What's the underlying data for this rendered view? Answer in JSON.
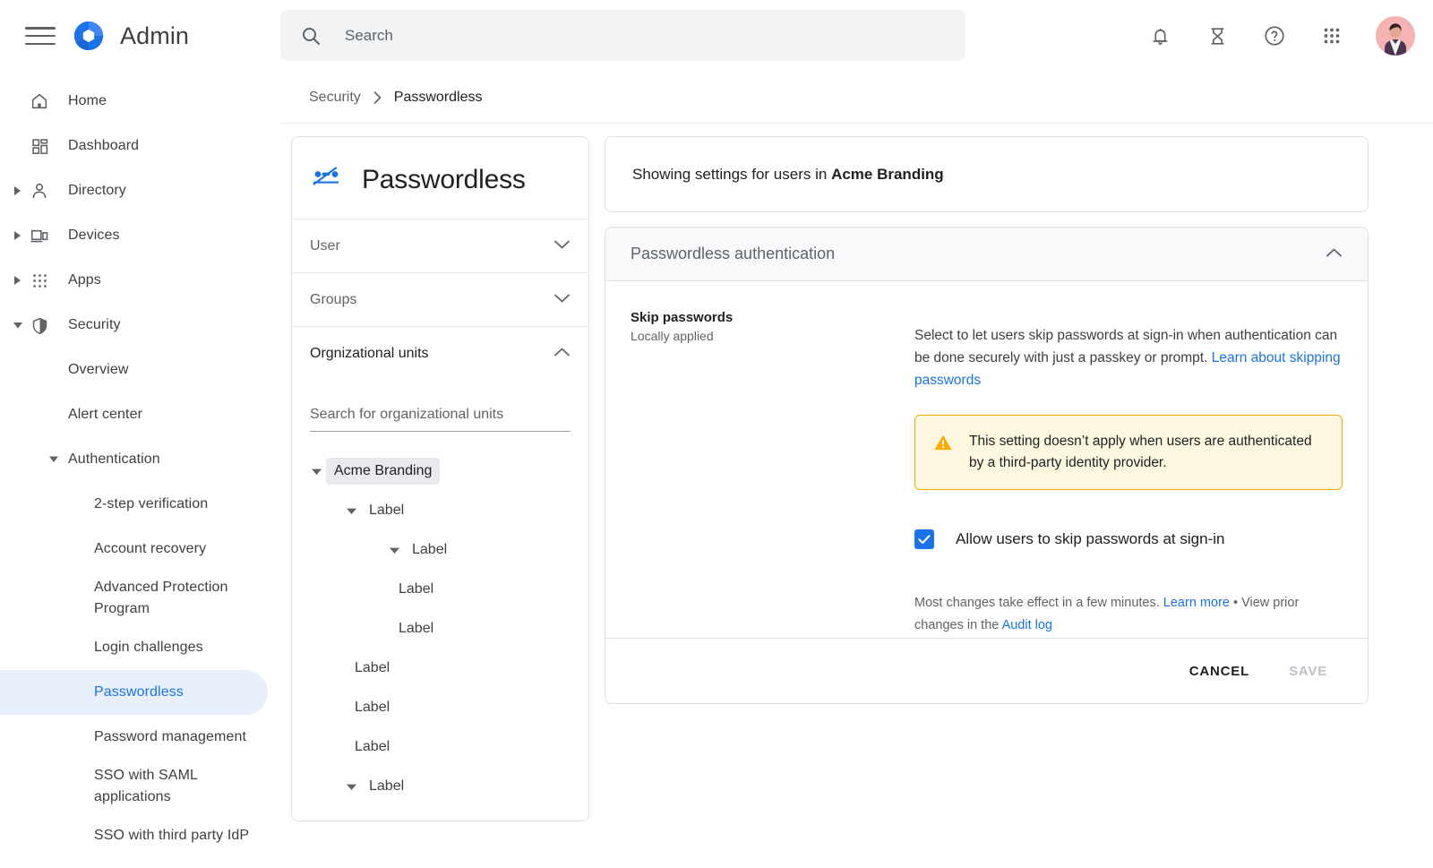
{
  "topbar": {
    "menu_icon": "hamburger-menu-icon",
    "logo_icon": "google-admin-logo",
    "app_title": "Admin",
    "search": {
      "placeholder": "Search",
      "value": "",
      "icon": "search-icon"
    },
    "icons": [
      {
        "name": "notifications-bell-icon",
        "label": "Notifications"
      },
      {
        "name": "hourglass-icon",
        "label": "Tasks"
      },
      {
        "name": "help-circle-icon",
        "label": "Help"
      },
      {
        "name": "apps-grid-icon",
        "label": "Google apps"
      }
    ],
    "avatar": {
      "name": "user-avatar",
      "label": "Account"
    }
  },
  "breadcrumb": {
    "items": [
      {
        "label": "Security",
        "current": false
      },
      {
        "label": "Passwordless",
        "current": true
      }
    ],
    "separator": "›"
  },
  "sidebar": {
    "items": [
      {
        "label": "Home",
        "icon": "home-icon",
        "caret": "none",
        "level": 0
      },
      {
        "label": "Dashboard",
        "icon": "dashboard-icon",
        "caret": "none",
        "level": 0
      },
      {
        "label": "Directory",
        "icon": "person-icon",
        "caret": "collapsed",
        "level": 0
      },
      {
        "label": "Devices",
        "icon": "devices-icon",
        "caret": "collapsed",
        "level": 0
      },
      {
        "label": "Apps",
        "icon": "apps-grid-icon",
        "caret": "collapsed",
        "level": 0
      },
      {
        "label": "Security",
        "icon": "shield-icon",
        "caret": "expanded",
        "level": 0
      }
    ],
    "security_children": [
      {
        "label": "Overview",
        "level": 1,
        "caret": "none",
        "active": false
      },
      {
        "label": "Alert center",
        "level": 1,
        "caret": "none",
        "active": false
      },
      {
        "label": "Authentication",
        "level": 1,
        "caret": "expanded",
        "active": false
      },
      {
        "label": "2-step verification",
        "level": 2,
        "caret": "none",
        "active": false
      },
      {
        "label": "Account recovery",
        "level": 2,
        "caret": "none",
        "active": false
      },
      {
        "label": "Advanced Protection Program",
        "level": 2,
        "caret": "none",
        "active": false
      },
      {
        "label": "Login challenges",
        "level": 2,
        "caret": "none",
        "active": false
      },
      {
        "label": "Passwordless",
        "level": 2,
        "caret": "none",
        "active": true
      },
      {
        "label": "Password management",
        "level": 2,
        "caret": "none",
        "active": false
      },
      {
        "label": "SSO with SAML applications",
        "level": 2,
        "caret": "none",
        "active": false
      },
      {
        "label": "SSO with third party IdP",
        "level": 2,
        "caret": "none",
        "active": false
      }
    ]
  },
  "ou_panel": {
    "icon": "password-off-icon",
    "title": "Passwordless",
    "sections": [
      {
        "label": "User",
        "state": "collapsed",
        "chevron": "chevron-down-icon"
      },
      {
        "label": "Groups",
        "state": "collapsed",
        "chevron": "chevron-down-icon"
      },
      {
        "label": "Orgnizational units",
        "state": "expanded",
        "chevron": "chevron-up-icon"
      }
    ],
    "search": {
      "placeholder": "Search for organizational units",
      "value": ""
    },
    "tree": [
      {
        "label": "Acme Branding",
        "indent": 0,
        "caret": "expanded",
        "selected": true
      },
      {
        "label": "Label",
        "indent": 1,
        "caret": "expanded",
        "selected": false
      },
      {
        "label": "Label",
        "indent": 2,
        "caret": "expanded",
        "selected": false
      },
      {
        "label": "Label",
        "indent": 3,
        "caret": "none",
        "selected": false
      },
      {
        "label": "Label",
        "indent": 3,
        "caret": "none",
        "selected": false
      },
      {
        "label": "Label",
        "indent": 1,
        "caret": "none",
        "selected": false
      },
      {
        "label": "Label",
        "indent": 1,
        "caret": "none",
        "selected": false
      },
      {
        "label": "Label",
        "indent": 1,
        "caret": "none",
        "selected": false
      },
      {
        "label": "Label",
        "indent": 1,
        "caret": "expanded",
        "selected": false
      }
    ]
  },
  "content": {
    "scope_banner_prefix": "Showing settings for users in ",
    "scope_banner_org": "Acme Branding",
    "section": {
      "title": "Passwordless authentication",
      "state": "expanded",
      "chevron": "chevron-up-icon"
    },
    "setting": {
      "name": "Skip passwords",
      "applied": "Locally applied",
      "description": "Select to let users skip passwords at sign-in when authentication can be done securely with just a passkey or prompt. ",
      "description_link": "Learn about skipping passwords",
      "warning": {
        "icon": "warning-triangle-icon",
        "text": "This setting doesn’t apply when users are authenticated by a third-party identity provider."
      },
      "checkbox": {
        "label": "Allow users to skip passwords at sign-in",
        "checked": true,
        "icon": "checkmark-icon"
      },
      "footnote_line1_prefix": "Most changes take effect in a few minutes. ",
      "footnote_link1": "Learn more",
      "footnote_separator": " • ",
      "footnote_line2_prefix": "View prior changes in the ",
      "footnote_link2": "Audit log"
    },
    "actions": {
      "cancel_label": "CANCEL",
      "save_label": "SAVE",
      "save_disabled": true
    }
  },
  "colors": {
    "accent_blue": "#1a73e8",
    "highlight_bg": "#e8f0fe",
    "warning_bg": "#fef7e0",
    "warning_border": "#f9ab00",
    "surface_gray": "#f8f9fa",
    "search_bg": "#f1f3f4",
    "text_primary": "#202124",
    "text_secondary": "#5f6368",
    "border": "#e0e0e0"
  }
}
